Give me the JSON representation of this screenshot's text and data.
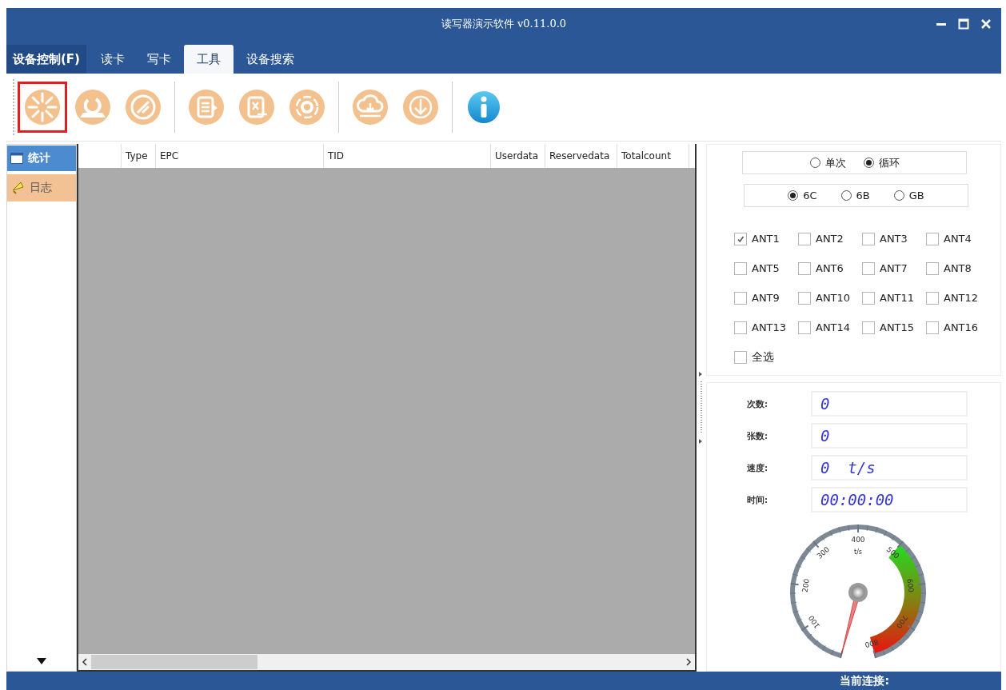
{
  "window": {
    "title": "读写器演示软件 v0.11.0.0"
  },
  "menu_tabs": [
    {
      "label": "设备控制(F)",
      "kind": "menu",
      "selected": false
    },
    {
      "label": "读卡",
      "kind": "tab",
      "selected": false
    },
    {
      "label": "写卡",
      "kind": "tab",
      "selected": false
    },
    {
      "label": "工具",
      "kind": "tab",
      "selected": true
    },
    {
      "label": "设备搜索",
      "kind": "tab",
      "selected": false
    }
  ],
  "toolbar": {
    "groups": [
      [
        {
          "selected": true
        },
        {
          "selected": false
        },
        {
          "selected": false
        }
      ],
      [
        {
          "selected": false
        },
        {
          "selected": false
        },
        {
          "selected": false
        }
      ],
      [
        {
          "selected": false
        },
        {
          "selected": false
        }
      ],
      [
        {
          "selected": false
        }
      ]
    ]
  },
  "sidebar": {
    "items": [
      {
        "label": "统计",
        "selected": true
      },
      {
        "label": "日志",
        "selected": false
      }
    ]
  },
  "table": {
    "columns": [
      "Type",
      "EPC",
      "TID",
      "Userdata",
      "Reservedata",
      "Totalcount"
    ]
  },
  "read_mode": [
    {
      "label": "单次",
      "selected": false
    },
    {
      "label": "循环",
      "selected": true
    }
  ],
  "protocol": [
    {
      "label": "6C",
      "selected": true
    },
    {
      "label": "6B",
      "selected": false
    },
    {
      "label": "GB",
      "selected": false
    }
  ],
  "antennas": [
    {
      "label": "ANT1",
      "checked": true
    },
    {
      "label": "ANT2",
      "checked": false
    },
    {
      "label": "ANT3",
      "checked": false
    },
    {
      "label": "ANT4",
      "checked": false
    },
    {
      "label": "ANT5",
      "checked": false
    },
    {
      "label": "ANT6",
      "checked": false
    },
    {
      "label": "ANT7",
      "checked": false
    },
    {
      "label": "ANT8",
      "checked": false
    },
    {
      "label": "ANT9",
      "checked": false
    },
    {
      "label": "ANT10",
      "checked": false
    },
    {
      "label": "ANT11",
      "checked": false
    },
    {
      "label": "ANT12",
      "checked": false
    },
    {
      "label": "ANT13",
      "checked": false
    },
    {
      "label": "ANT14",
      "checked": false
    },
    {
      "label": "ANT15",
      "checked": false
    },
    {
      "label": "ANT16",
      "checked": false
    }
  ],
  "select_all": {
    "label": "全选",
    "checked": false
  },
  "stats": [
    {
      "label": "次数:",
      "value": "0"
    },
    {
      "label": "张数:",
      "value": "0"
    },
    {
      "label": "速度:",
      "value": "0  t/s"
    },
    {
      "label": "时间:",
      "value": "00:00:00"
    }
  ],
  "gauge": {
    "unit": "t/s",
    "labels": [
      "100",
      "200",
      "300",
      "400",
      "500",
      "600",
      "700",
      "800"
    ]
  },
  "status_bar": {
    "label": "当前连接:"
  }
}
